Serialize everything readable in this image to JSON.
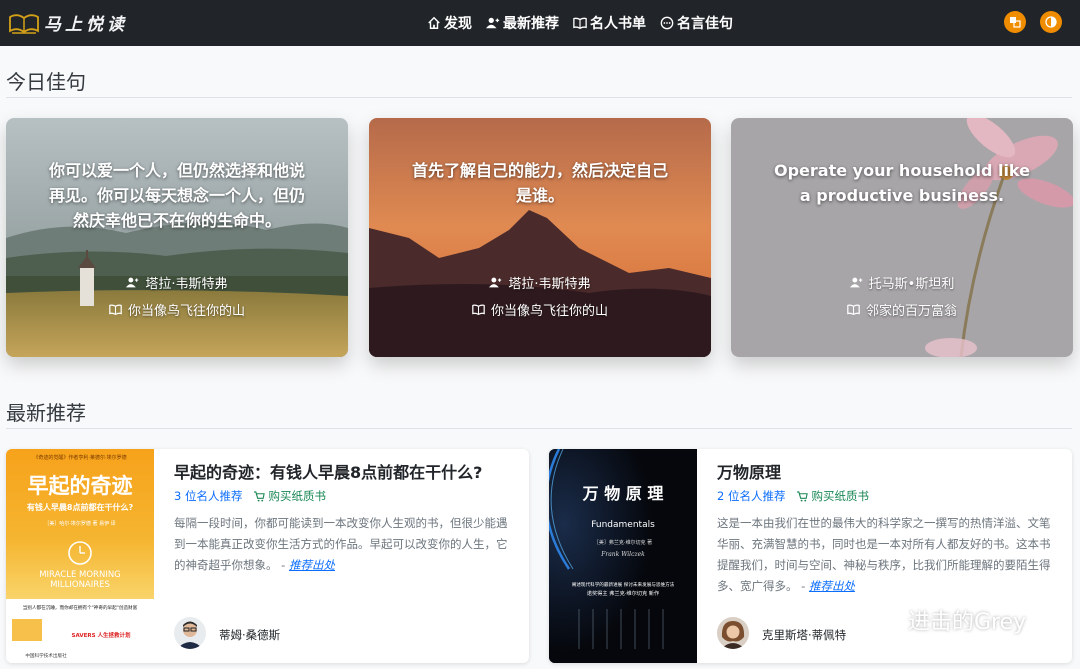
{
  "brand": {
    "name": "马上悦读"
  },
  "nav": {
    "items": [
      {
        "label": "发现",
        "icon": "home-icon"
      },
      {
        "label": "最新推荐",
        "icon": "users-icon"
      },
      {
        "label": "名人书单",
        "icon": "book-icon"
      },
      {
        "label": "名言佳句",
        "icon": "chat-icon"
      }
    ],
    "right_buttons": [
      "translate-icon",
      "theme-toggle-icon"
    ]
  },
  "quotes_section": {
    "title": "今日佳句",
    "cards": [
      {
        "text": "你可以爱一个人，但仍然选择和他说再见。你可以每天想念一个人，但仍然庆幸他已不在你的生命中。",
        "author": "塔拉·韦斯特弗",
        "book": "你当像鸟飞往你的山"
      },
      {
        "text": "首先了解自己的能力，然后决定自己是谁。",
        "author": "塔拉·韦斯特弗",
        "book": "你当像鸟飞往你的山"
      },
      {
        "text": "Operate your household like a productive business.",
        "author": "托马斯•斯坦利",
        "book": "邻家的百万富翁"
      }
    ]
  },
  "latest_section": {
    "title": "最新推荐",
    "books": [
      {
        "title": "早起的奇迹：有钱人早晨8点前都在干什么?",
        "recommenders": "3 位名人推荐",
        "buy": "购买纸质书",
        "desc": "每隔一段时间，你都可能读到一本改变你人生观的书，但很少能遇到一本能真正改变你生活方式的作品。早起可以改变你的人生，它的神奇超乎你想象。 - ",
        "source": "推荐出处",
        "person": "蒂姆·桑德斯",
        "cover": {
          "top_note": "《奇迹的觉醒》作者亨利·莱德尔·埃尔罗德",
          "title": "早起的奇迹",
          "subtitle": "有钱人早晨8点前都在干什么?",
          "authors": "［美］哈尔·埃尔罗德 著  易伊 译",
          "en1": "MIRACLE MORNING",
          "en2": "MILLIONAIRES",
          "bottom1": "当别人都在沉睡，而你却在拥有个\"神奇的早起\"创造财富",
          "bottom2": "SAVERS 人生拯救计划",
          "publisher": "中国科学技术出版社"
        }
      },
      {
        "title": "万物原理",
        "recommenders": "2 位名人推荐",
        "buy": "购买纸质书",
        "desc": "这是一本由我们在世的最伟大的科学家之一撰写的热情洋溢、文笔华丽、充满智慧的书，同时也是一本对所有人都友好的书。这本书提醒我们，时间与空间、神秘与秩序，比我们所能理解的要陌生得多、宽广得多。 - ",
        "source": "推荐出处",
        "person": "克里斯塔·蒂佩特",
        "cover": {
          "title": "万 物 原 理",
          "subtitle": "Fundamentals",
          "authors": "［美］弗兰克·维尔切克 著",
          "signature": "Frank Wilczek",
          "tagline1": "阐述现代科学的最新进展  探讨未来发展与思维方法",
          "tagline2": "诺奖得主 弗兰克·维尔切克 新作"
        }
      }
    ]
  },
  "watermark": {
    "text": "进击的Grey"
  },
  "colors": {
    "navbar": "#212529",
    "accent": "#f08c00",
    "link": "#0d6efd",
    "buy": "#198754"
  }
}
